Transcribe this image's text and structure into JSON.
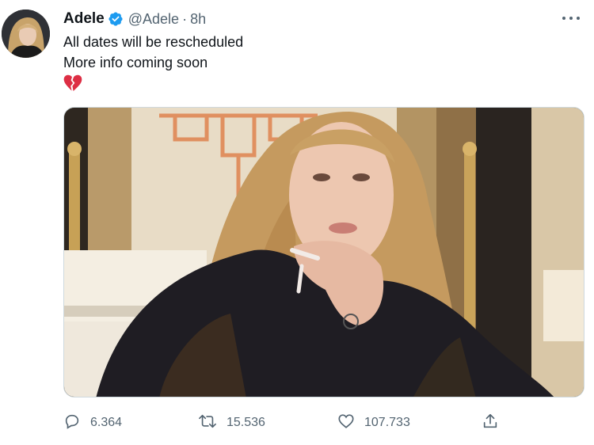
{
  "author": {
    "name": "Adele",
    "handle": "@Adele",
    "separator": "·",
    "time": "8h",
    "verified": true
  },
  "tweet": {
    "lines": [
      "All dates will be rescheduled",
      "More info coming soon"
    ],
    "emoji": "broken-heart"
  },
  "stats": {
    "replies": "6.364",
    "retweets": "15.536",
    "likes": "107.733"
  },
  "colors": {
    "verified": "#1d9bf0",
    "muted": "#536471",
    "emoji": "#dd2e44"
  },
  "icons": {
    "reply": "reply-icon",
    "retweet": "retweet-icon",
    "like": "heart-icon",
    "share": "share-icon",
    "more": "more-icon"
  }
}
